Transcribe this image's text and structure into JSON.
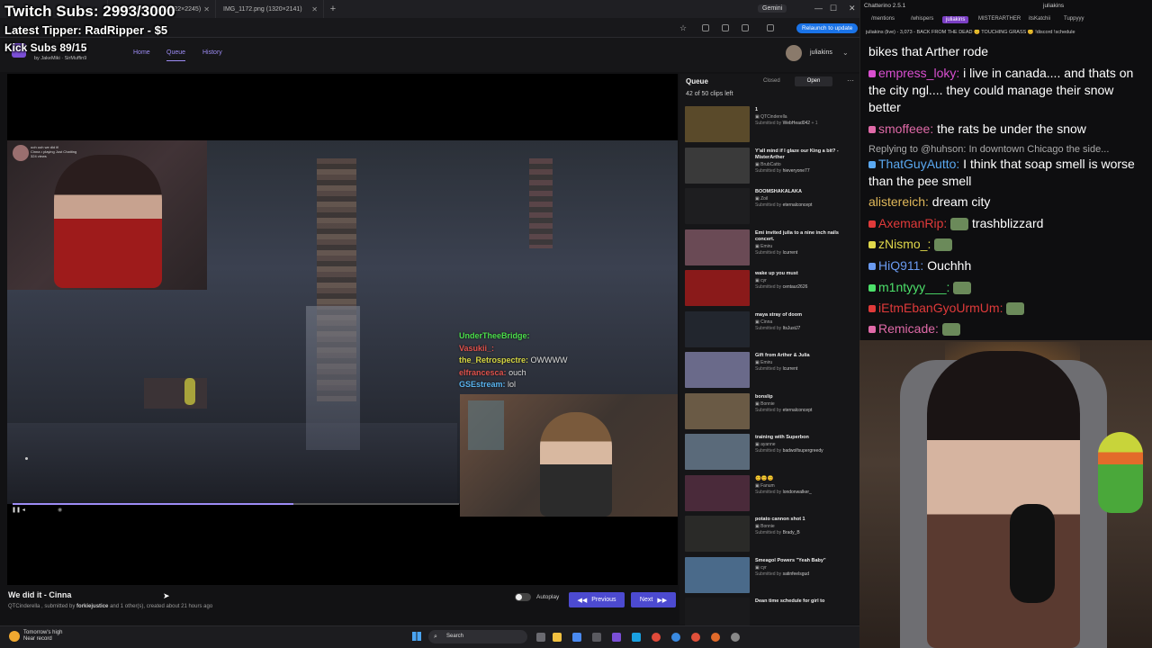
{
  "browser": {
    "tabs": [
      {
        "label": "Prison_Break.jpg (1622×2245)"
      },
      {
        "label": "IMG_1172.png (1320×2141)"
      }
    ],
    "gemini_label": "Gemini",
    "relaunch_label": "Relaunch to update"
  },
  "overlay": {
    "subs": "Twitch Subs: 2993/3000",
    "tipper": "Latest Tipper: RadRipper - $5",
    "kick": "Kick Subs 89/15"
  },
  "header": {
    "byline": "by JakeMiki · SirMuffin9",
    "nav": [
      "Home",
      "Queue",
      "History"
    ],
    "username": "juliakins"
  },
  "player": {
    "ingame_chat": [
      {
        "name": "UnderTheeBridge:",
        "text": "",
        "color": "#4ce04c"
      },
      {
        "name": "Vasukii_:",
        "text": "",
        "color": "#e0524c"
      },
      {
        "name": "the_Retrospectre:",
        "text": "OWWWW",
        "color": "#d6d642"
      },
      {
        "name": "elfrancesca:",
        "text": "ouch",
        "color": "#e0524c"
      },
      {
        "name": "GSEstream:",
        "text": "lol",
        "color": "#5ab4f0"
      }
    ],
    "cam_left_meta": [
      "ooh ooh we did it!",
      "Cinna • playing Just Chatting",
      "324 views"
    ],
    "progress": 0.63
  },
  "clip": {
    "title": "We did it - Cinna",
    "meta_prefix": "QTCinderella , submitted by",
    "submitter": "forkiejustice",
    "meta_suffix": "and 1 other(s), created about 21 hours ago",
    "autoplay_label": "Autoplay",
    "previous_label": "Previous",
    "next_label": "Next"
  },
  "queue": {
    "title": "Queue",
    "count": "42 of 50 clips left",
    "closed_label": "Closed",
    "open_label": "Open",
    "items": [
      {
        "title": "1",
        "channel": "QTCinderella",
        "submitter": "WebHead042",
        "extra": "+ 1",
        "thumb": "#5a4a2a"
      },
      {
        "title": "Y'all mind if I glaze our King a bit? - MisterArther",
        "channel": "BrubCatto",
        "submitter": "hieveryone77",
        "extra": "",
        "thumb": "#3a3a3a"
      },
      {
        "title": "BOOMSHAKALAKA",
        "channel": "Zoil",
        "submitter": "eternalconcept",
        "extra": "",
        "thumb": "#1e1e20"
      },
      {
        "title": "Emi invited julia to a nine inch nails concert.",
        "channel": "Emiru",
        "submitter": "lcurrent",
        "extra": "",
        "thumb": "#6a4a55"
      },
      {
        "title": "wake up you must",
        "channel": "cyr",
        "submitter": "centaur2626",
        "extra": "",
        "thumb": "#8a1a1a"
      },
      {
        "title": "maya stray of doom",
        "channel": "Cinna",
        "submitter": "ItsJustJ7",
        "extra": "",
        "thumb": "#22262e"
      },
      {
        "title": "Gift from Arther & Julia",
        "channel": "Emiru",
        "submitter": "lcurrent",
        "extra": "",
        "thumb": "#6a6a8a"
      },
      {
        "title": "bonslip",
        "channel": "Bonnie",
        "submitter": "eternalconcept",
        "extra": "",
        "thumb": "#6a5a45"
      },
      {
        "title": "training with Superbon",
        "channel": "ayanne",
        "submitter": "badwolfsupergreedy",
        "extra": "",
        "thumb": "#5a6a7a"
      },
      {
        "title": "😊😊😊",
        "channel": "Fanum",
        "submitter": "londonwalker_",
        "extra": "",
        "thumb": "#4a2a3a"
      },
      {
        "title": "potato cannon shot 1",
        "channel": "Bonnie",
        "submitter": "Brady_B",
        "extra": "",
        "thumb": "#2a2a28"
      },
      {
        "title": "Smeagol Powers \"Yeah Baby\"",
        "channel": "cyr",
        "submitter": "satinfeelsgud",
        "extra": "",
        "thumb": "#4a6a8a"
      },
      {
        "title": "Dean time schedule for girl to",
        "channel": "",
        "submitter": "",
        "extra": "",
        "thumb": "#1a1a1c"
      }
    ]
  },
  "chat": {
    "app_title": "Chatterino 2.5.1",
    "user": "juliakins",
    "tabs": [
      "/mentions",
      "/whispers",
      "juliakins",
      "MISTERARTHER",
      "itsKatchii",
      "Tuppyyy"
    ],
    "status": "juliakins (live) - 3,073 - BACK FROM THE DEAD 😊 TOUCHING GRASS 😊 !discord !schedule",
    "messages": [
      {
        "name": "",
        "text": "bikes that Arther rode",
        "color": "#ffffff"
      },
      {
        "name": "empress_loky:",
        "text": " i live in canada.... and thats on the city ngl.... they could manage their snow better",
        "color": "#d94fd0"
      },
      {
        "name": "smoffeee:",
        "text": " the rats be under the snow",
        "color": "#e06aa8"
      },
      {
        "name": "Replying to @huhson:",
        "text": " In downtown Chicago the side...",
        "color": "#aaaaaa"
      },
      {
        "name": "ThatGuyAutto:",
        "text": " I think that soap smell is worse than the pee smell",
        "color": "#5aa8f0"
      },
      {
        "name": "alistereich:",
        "text": " dream city",
        "color": "#e0b85a"
      },
      {
        "name": "AxemanRip:",
        "text": " trashblizzard",
        "color": "#e03a3a"
      },
      {
        "name": "zNismo_:",
        "text": "",
        "color": "#e0d84a"
      },
      {
        "name": "HiQ911:",
        "text": " Ouchhh",
        "color": "#6a9af0"
      },
      {
        "name": "m1ntyyy___:",
        "text": "",
        "color": "#4ce06a"
      },
      {
        "name": "iEtmEbanGyoUrmUm:",
        "text": "",
        "color": "#e03a3a"
      },
      {
        "name": "Remicade:",
        "text": "",
        "color": "#e06aa8"
      }
    ]
  },
  "taskbar": {
    "weather_title": "Tomorrow's high",
    "weather_sub": "Near record",
    "search_label": "Search"
  }
}
